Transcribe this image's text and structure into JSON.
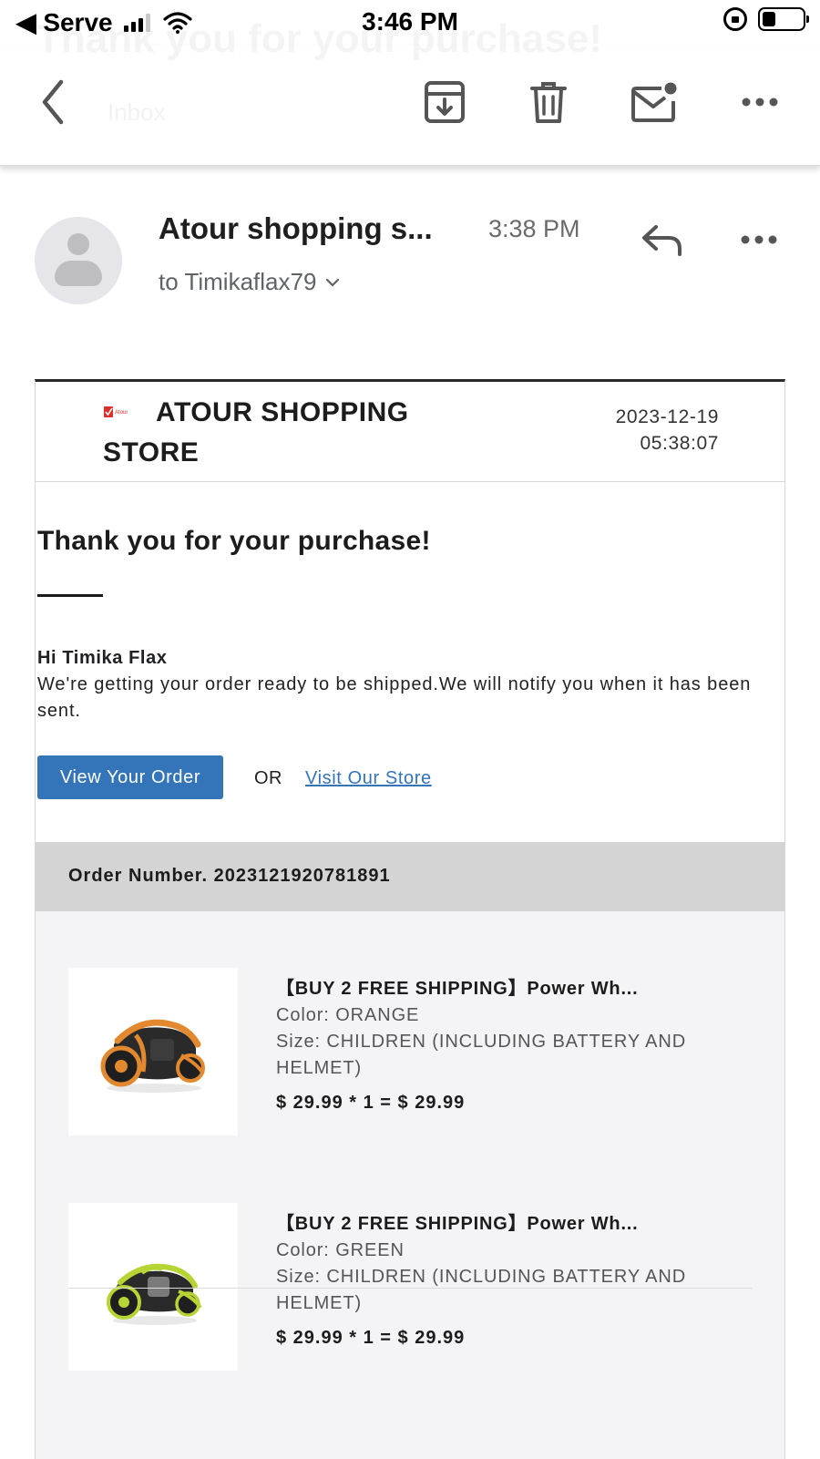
{
  "status_bar": {
    "back_label": "◀ Serve",
    "time": "3:46 PM"
  },
  "ghost": {
    "title": "Thank you for your purchase!",
    "folder": "Inbox"
  },
  "toolbar": {
    "icons": [
      "back-chevron-icon",
      "archive-icon",
      "trash-icon",
      "mark-unread-icon",
      "more-icon"
    ]
  },
  "email": {
    "sender": "Atour shopping s...",
    "time": "3:38 PM",
    "recipient": "to Timikaflax79"
  },
  "store": {
    "name": "ATOUR SHOPPING STORE",
    "logo_text": "Atour",
    "date": "2023-12-19",
    "clock": "05:38:07"
  },
  "body": {
    "heading": "Thank you for your purchase!",
    "greeting": "Hi Timika Flax",
    "message": "We're getting your order ready to be shipped.We will notify you when it has been sent.",
    "view_order_label": "View Your Order",
    "or_label": "OR",
    "visit_store_label": "Visit Our Store"
  },
  "order": {
    "number_label": "Order Number. 2023121920781891"
  },
  "items": [
    {
      "title": "【BUY 2 FREE SHIPPING】Power Wh...",
      "color": "Color: ORANGE",
      "size": "Size: CHILDREN (INCLUDING BATTERY AND HELMET)",
      "price": "$ 29.99 * 1 = $ 29.99",
      "accent": "#e2882f"
    },
    {
      "title": "【BUY 2 FREE SHIPPING】Power Wh...",
      "color": "Color: GREEN",
      "size": "Size: CHILDREN (INCLUDING BATTERY AND HELMET)",
      "price": "$ 29.99 * 1 = $ 29.99",
      "accent": "#b6d433"
    }
  ],
  "colors": {
    "button_blue": "#3474b8",
    "order_bar": "#d4d4d4"
  }
}
